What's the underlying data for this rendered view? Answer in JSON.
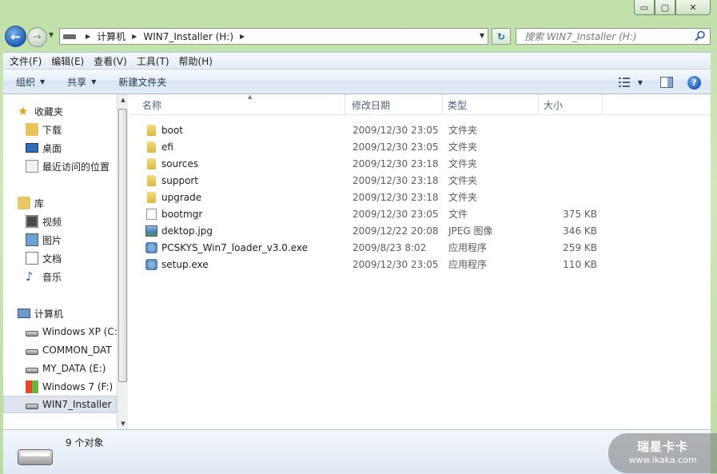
{
  "titlebar": {
    "minimize": "▭",
    "maximize": "▢",
    "close": "✕"
  },
  "address": {
    "crumbs": [
      "计算机",
      "WIN7_Installer (H:)"
    ],
    "search_placeholder": "搜索 WIN7_Installer (H:)"
  },
  "menu": [
    "文件(F)",
    "编辑(E)",
    "查看(V)",
    "工具(T)",
    "帮助(H)"
  ],
  "toolbar": {
    "organize": "组织",
    "share": "共享",
    "new_folder": "新建文件夹",
    "help": "?"
  },
  "nav": {
    "favorites": "收藏夹",
    "downloads": "下载",
    "desktop": "桌面",
    "recent": "最近访问的位置",
    "libraries": "库",
    "videos": "视频",
    "pictures": "图片",
    "documents": "文档",
    "music": "音乐",
    "computer": "计算机",
    "drives": [
      "Windows XP (C:",
      "COMMON_DAT",
      "MY_DATA (E:)",
      "Windows 7 (F:)",
      "WIN7_Installer"
    ]
  },
  "columns": {
    "name": "名称",
    "date": "修改日期",
    "type": "类型",
    "size": "大小"
  },
  "files": [
    {
      "name": "boot",
      "date": "2009/12/30 23:05",
      "type": "文件夹",
      "size": "",
      "icon": "folder"
    },
    {
      "name": "efi",
      "date": "2009/12/30 23:05",
      "type": "文件夹",
      "size": "",
      "icon": "folder"
    },
    {
      "name": "sources",
      "date": "2009/12/30 23:18",
      "type": "文件夹",
      "size": "",
      "icon": "folder"
    },
    {
      "name": "support",
      "date": "2009/12/30 23:18",
      "type": "文件夹",
      "size": "",
      "icon": "folder"
    },
    {
      "name": "upgrade",
      "date": "2009/12/30 23:18",
      "type": "文件夹",
      "size": "",
      "icon": "folder"
    },
    {
      "name": "bootmgr",
      "date": "2009/12/30 23:05",
      "type": "文件",
      "size": "375 KB",
      "icon": "file"
    },
    {
      "name": "dektop.jpg",
      "date": "2009/12/22 20:08",
      "type": "JPEG 图像",
      "size": "346 KB",
      "icon": "image"
    },
    {
      "name": "PCSKYS_Win7_loader_v3.0.exe",
      "date": "2009/8/23 8:02",
      "type": "应用程序",
      "size": "259 KB",
      "icon": "exe"
    },
    {
      "name": "setup.exe",
      "date": "2009/12/30 23:05",
      "type": "应用程序",
      "size": "110 KB",
      "icon": "exe"
    }
  ],
  "details": {
    "count": "9 个对象"
  },
  "watermark": {
    "top": "瑞星卡卡",
    "bottom": "www.ikaka.com"
  }
}
